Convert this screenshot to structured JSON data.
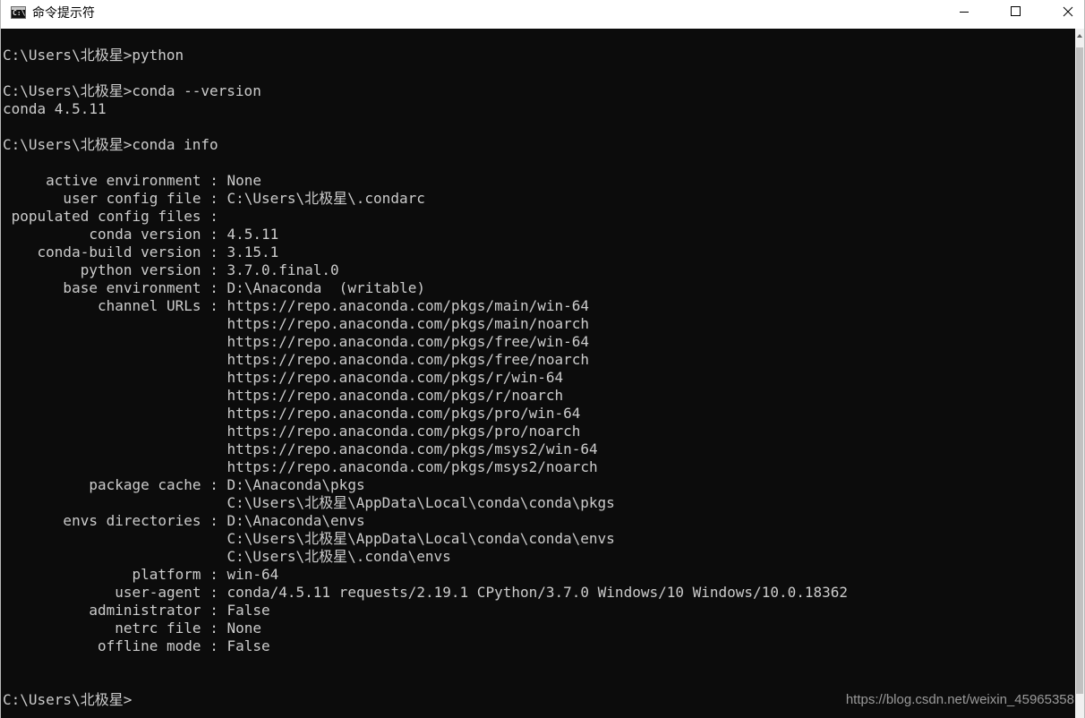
{
  "window": {
    "title": "命令提示符",
    "icon": "cmd-icon",
    "icon_glyph": "C:\\",
    "controls": {
      "minimize_icon": "minimize-icon",
      "maximize_icon": "maximize-icon",
      "close_icon": "close-icon"
    }
  },
  "console": {
    "colors": {
      "background": "#0c0c0c",
      "text": "#cccccc"
    },
    "lines": [
      "C:\\Users\\北极星>python",
      "",
      "C:\\Users\\北极星>conda --version",
      "conda 4.5.11",
      "",
      "C:\\Users\\北极星>conda info",
      "",
      "     active environment : None",
      "       user config file : C:\\Users\\北极星\\.condarc",
      " populated config files :",
      "          conda version : 4.5.11",
      "    conda-build version : 3.15.1",
      "         python version : 3.7.0.final.0",
      "       base environment : D:\\Anaconda  (writable)",
      "           channel URLs : https://repo.anaconda.com/pkgs/main/win-64",
      "                          https://repo.anaconda.com/pkgs/main/noarch",
      "                          https://repo.anaconda.com/pkgs/free/win-64",
      "                          https://repo.anaconda.com/pkgs/free/noarch",
      "                          https://repo.anaconda.com/pkgs/r/win-64",
      "                          https://repo.anaconda.com/pkgs/r/noarch",
      "                          https://repo.anaconda.com/pkgs/pro/win-64",
      "                          https://repo.anaconda.com/pkgs/pro/noarch",
      "                          https://repo.anaconda.com/pkgs/msys2/win-64",
      "                          https://repo.anaconda.com/pkgs/msys2/noarch",
      "          package cache : D:\\Anaconda\\pkgs",
      "                          C:\\Users\\北极星\\AppData\\Local\\conda\\conda\\pkgs",
      "       envs directories : D:\\Anaconda\\envs",
      "                          C:\\Users\\北极星\\AppData\\Local\\conda\\conda\\envs",
      "                          C:\\Users\\北极星\\.conda\\envs",
      "               platform : win-64",
      "             user-agent : conda/4.5.11 requests/2.19.1 CPython/3.7.0 Windows/10 Windows/10.0.18362",
      "          administrator : False",
      "             netrc file : None",
      "           offline mode : False",
      "",
      "",
      "C:\\Users\\北极星>"
    ]
  },
  "scrollbar": {
    "up_icon": "scroll-up-arrow-icon",
    "position_fraction": 0.94
  },
  "watermark": "https://blog.csdn.net/weixin_45965358"
}
